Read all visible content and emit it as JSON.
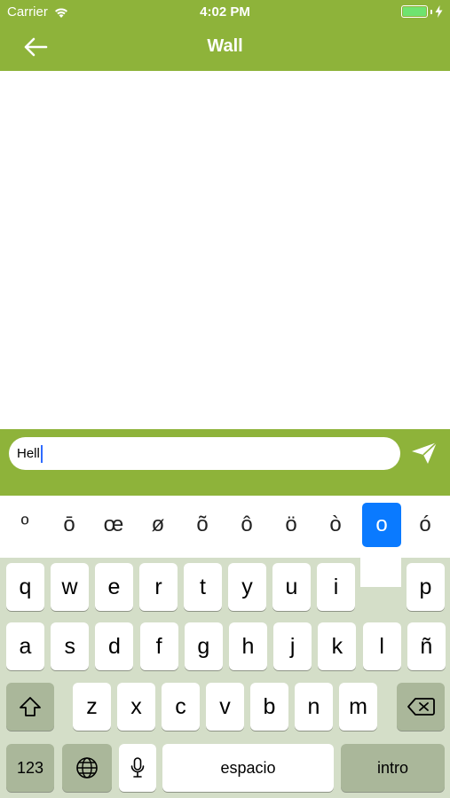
{
  "status_bar": {
    "carrier": "Carrier",
    "time": "4:02 PM",
    "battery_level": 1.0,
    "wifi_icon": "wifi-icon",
    "battery_icon": "battery-icon",
    "charging_icon": "charging-bolt-icon"
  },
  "nav": {
    "title": "Wall",
    "back_icon": "arrow-left-icon"
  },
  "composer": {
    "input_value": "Hell",
    "send_icon": "paper-plane-icon"
  },
  "accent_options": [
    "º",
    "ō",
    "œ",
    "ø",
    "õ",
    "ô",
    "ö",
    "ò",
    "o",
    "ó"
  ],
  "accent_selected_index": 8,
  "keyboard": {
    "row1": [
      "q",
      "w",
      "e",
      "r",
      "t",
      "y",
      "u",
      "i",
      "p"
    ],
    "row2": [
      "a",
      "s",
      "d",
      "f",
      "g",
      "h",
      "j",
      "k",
      "l",
      "ñ"
    ],
    "row3": [
      "z",
      "x",
      "c",
      "v",
      "b",
      "n",
      "m"
    ],
    "numbers_label": "123",
    "space_label": "espacio",
    "return_label": "intro",
    "shift_icon": "shift-icon",
    "delete_icon": "backspace-icon",
    "globe_icon": "globe-icon",
    "mic_icon": "microphone-icon"
  },
  "colors": {
    "brand_green": "#8eb33a",
    "selection_blue": "#0a7aff",
    "keyboard_bg": "#d4dec8"
  }
}
